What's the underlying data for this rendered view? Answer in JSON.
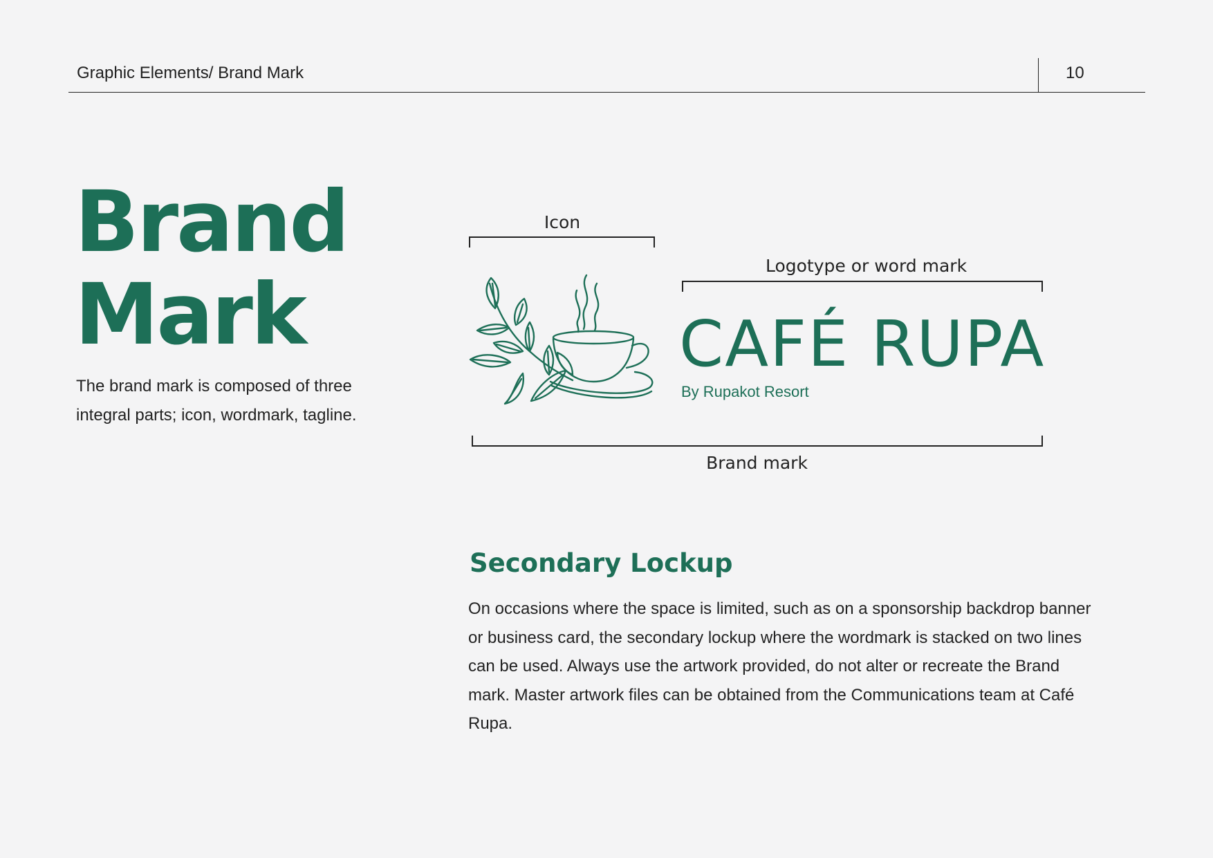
{
  "header": {
    "breadcrumb": "Graphic Elements/ Brand Mark",
    "page_number": "10"
  },
  "title": {
    "line1": "Brand",
    "line2": "Mark"
  },
  "intro": "The brand mark is composed of three integral parts; icon, wordmark, tagline.",
  "diagram": {
    "icon_label": "Icon",
    "wordmark_label": "Logotype or word mark",
    "brandmark_label": "Brand mark",
    "icon_name": "coffee-cup-with-leaves-icon",
    "wordmark": "CAFÉ RUPA",
    "tagline": "By Rupakot Resort"
  },
  "secondary_lockup": {
    "title": "Secondary Lockup",
    "body": "On occasions where the space is limited, such as on a sponsorship backdrop banner or business card, the secondary lockup where the wordmark is stacked on two lines can be used. Always use the artwork provided, do not alter or recreate the Brand mark. Master artwork files can be obtained from the Communications team at Café Rupa."
  },
  "colors": {
    "brand_green": "#1d6f57",
    "background": "#f4f4f5",
    "text": "#222222"
  }
}
